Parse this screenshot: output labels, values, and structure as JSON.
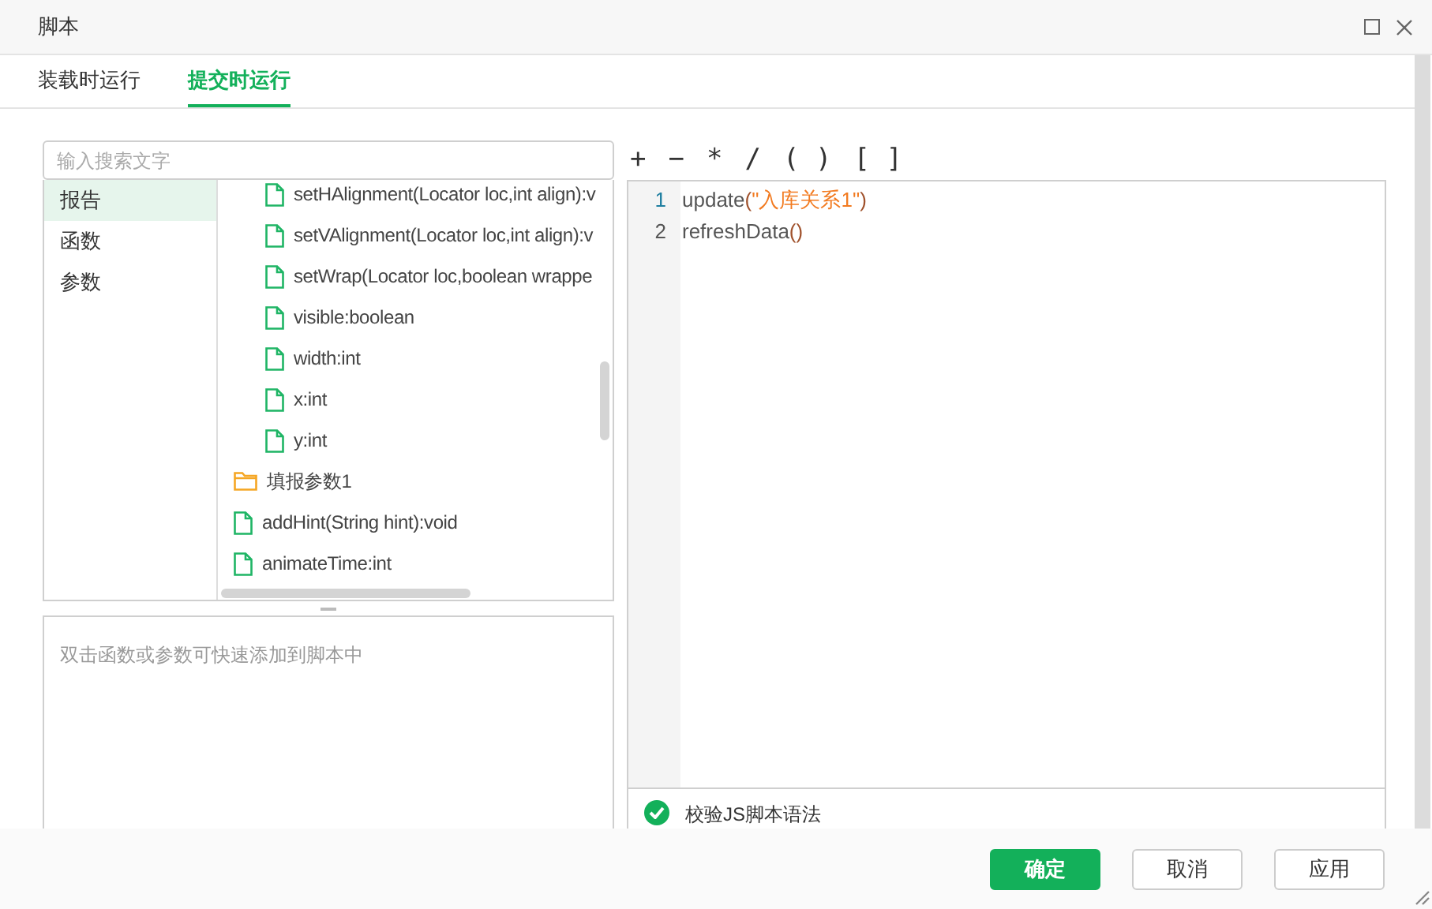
{
  "window": {
    "title": "脚本"
  },
  "tabs": [
    {
      "label": "装载时运行",
      "selected": false
    },
    {
      "label": "提交时运行",
      "selected": true
    }
  ],
  "search": {
    "placeholder": "输入搜索文字"
  },
  "categories": [
    {
      "label": "报告",
      "selected": true
    },
    {
      "label": "函数",
      "selected": false
    },
    {
      "label": "参数",
      "selected": false
    }
  ],
  "tree": [
    {
      "kind": "group",
      "children": [
        {
          "kind": "file",
          "label": "setHAlignment(Locator loc,int align):v"
        },
        {
          "kind": "file",
          "label": "setVAlignment(Locator loc,int align):v"
        },
        {
          "kind": "file",
          "label": "setWrap(Locator loc,boolean wrappe"
        },
        {
          "kind": "file",
          "label": "visible:boolean"
        },
        {
          "kind": "file",
          "label": "width:int"
        },
        {
          "kind": "file",
          "label": "x:int"
        },
        {
          "kind": "file",
          "label": "y:int"
        }
      ]
    },
    {
      "kind": "folder",
      "label": "填报参数1"
    },
    {
      "kind": "file",
      "label": "addHint(String hint):void"
    },
    {
      "kind": "file",
      "label": "animateTime:int"
    }
  ],
  "hint": "双击函数或参数可快速添加到脚本中",
  "operators": [
    "+",
    "−",
    "*",
    "/",
    "( )",
    "[ ]"
  ],
  "code_lines": [
    {
      "number": "1",
      "active": true,
      "tokens": [
        {
          "kind": "plain",
          "text": "update"
        },
        {
          "kind": "paren",
          "text": "("
        },
        {
          "kind": "string",
          "text": "\"入库关系1\""
        },
        {
          "kind": "paren",
          "text": ")"
        }
      ]
    },
    {
      "number": "2",
      "active": false,
      "tokens": [
        {
          "kind": "plain",
          "text": "refreshData"
        },
        {
          "kind": "paren",
          "text": "()"
        }
      ]
    }
  ],
  "validate": {
    "label": "校验JS脚本语法",
    "checked": true
  },
  "buttons": [
    {
      "label": "确定",
      "kind": "primary"
    },
    {
      "label": "取消",
      "kind": "secondary"
    },
    {
      "label": "应用",
      "kind": "secondary"
    }
  ]
}
